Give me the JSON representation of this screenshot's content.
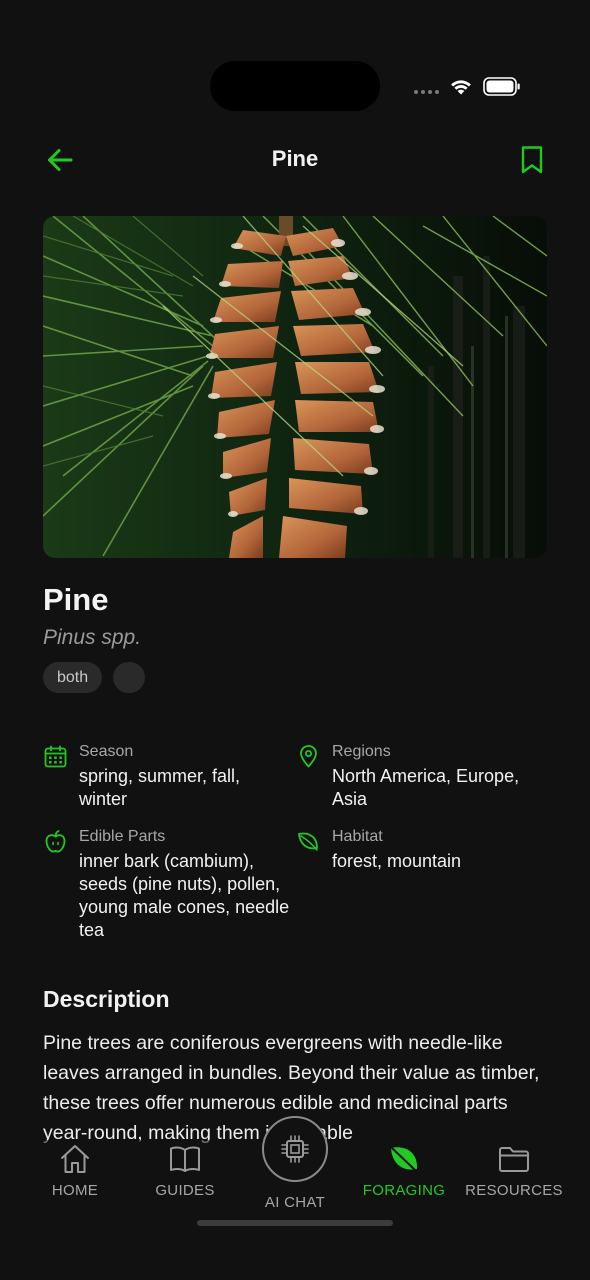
{
  "nav": {
    "title": "Pine"
  },
  "plant": {
    "name": "Pine",
    "scientific_name": "Pinus spp.",
    "tags": [
      "both",
      ""
    ]
  },
  "info": {
    "season": {
      "label": "Season",
      "value": "spring, summer, fall, winter"
    },
    "regions": {
      "label": "Regions",
      "value": "North America, Europe, Asia"
    },
    "edible_parts": {
      "label": "Edible Parts",
      "value": "inner bark (cambium), seeds (pine nuts), pollen, young male cones, needle tea"
    },
    "habitat": {
      "label": "Habitat",
      "value": "forest, mountain"
    }
  },
  "description": {
    "title": "Description",
    "text": "Pine trees are coniferous evergreens with needle-like leaves arranged in bundles. Beyond their value as timber, these trees offer numerous edible and medicinal parts year-round, making them invaluable"
  },
  "tabs": [
    {
      "label": "HOME",
      "icon": "home-icon"
    },
    {
      "label": "GUIDES",
      "icon": "book-icon"
    },
    {
      "label": "AI CHAT",
      "icon": "chip-icon"
    },
    {
      "label": "FORAGING",
      "icon": "leaf-icon"
    },
    {
      "label": "RESOURCES",
      "icon": "folder-icon"
    }
  ],
  "colors": {
    "accent": "#22c922",
    "background": "#111111",
    "muted_text": "#a6a6a6"
  }
}
